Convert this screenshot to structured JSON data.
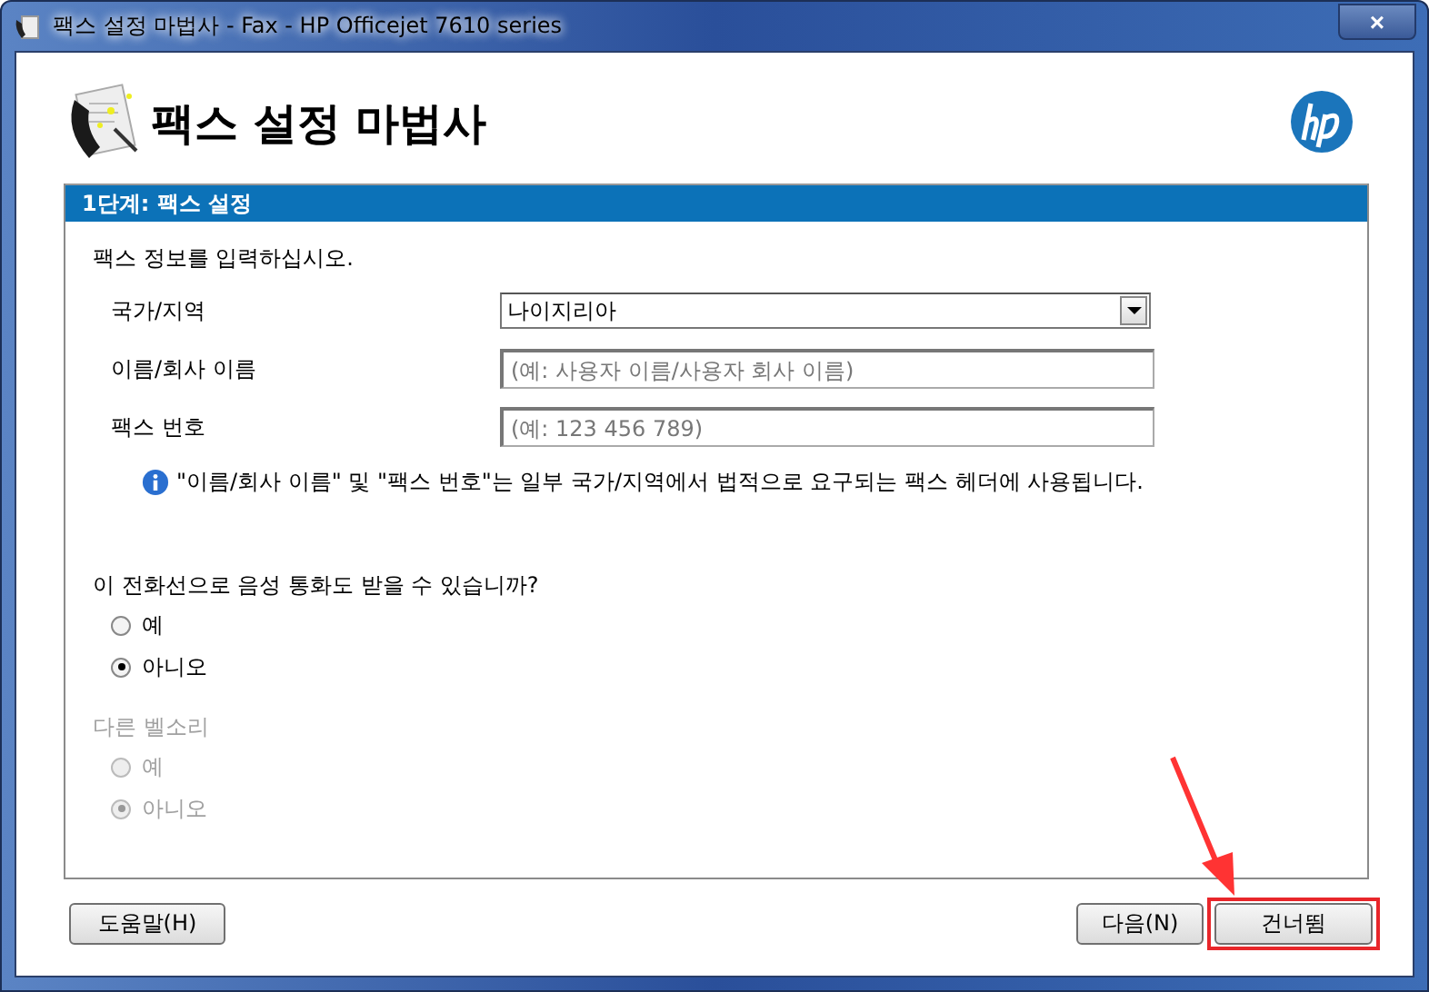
{
  "window": {
    "title": "팩스 설정 마법사 - Fax - HP Officejet 7610 series",
    "close": "×"
  },
  "header": {
    "title": "팩스 설정 마법사"
  },
  "step": {
    "title": "1단계: 팩스 설정"
  },
  "intro": "팩스 정보를 입력하십시오.",
  "fields": [
    {
      "kind": "select",
      "label": "국가/지역",
      "value": "나이지리아"
    },
    {
      "kind": "text",
      "label": "이름/회사 이름",
      "placeholder": "(예: 사용자 이름/사용자 회사 이름)"
    },
    {
      "kind": "text",
      "label": "팩스 번호",
      "placeholder": "(예: 123 456 789)"
    }
  ],
  "info": "\"이름/회사 이름\" 및 \"팩스 번호\"는 일부 국가/지역에서 법적으로 요구되는 팩스 헤더에 사용됩니다.",
  "groups": [
    {
      "label": "이 전화선으로 음성 통화도 받을 수 있습니까?",
      "disabled": false,
      "options": [
        {
          "label": "예",
          "selected": false
        },
        {
          "label": "아니오",
          "selected": true
        }
      ]
    },
    {
      "label": "다른 벨소리",
      "disabled": true,
      "options": [
        {
          "label": "예",
          "selected": false
        },
        {
          "label": "아니오",
          "selected": true
        }
      ]
    }
  ],
  "buttons_left": [
    {
      "label": "도움말(H)",
      "highlighted": false
    }
  ],
  "buttons_right": [
    {
      "label": "다음(N)",
      "highlighted": false
    },
    {
      "label": "건너뜀",
      "highlighted": true
    }
  ]
}
